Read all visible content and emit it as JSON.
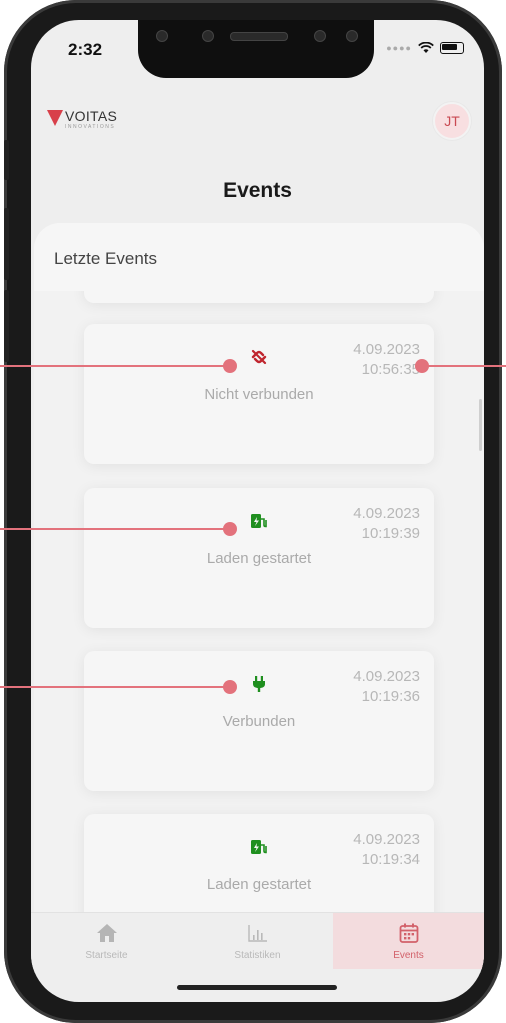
{
  "status_bar": {
    "time": "2:32"
  },
  "header": {
    "logo_name": "VOITAS",
    "logo_sub": "INNOVATIONS",
    "avatar_initials": "JT",
    "title": "Events"
  },
  "panel": {
    "title": "Letzte Events"
  },
  "events": [
    {
      "label": "Nicht verbunden",
      "date": "4.09.2023",
      "time": "10:56:35",
      "icon": "disconnected-icon",
      "color": "#c0262f"
    },
    {
      "label": "Laden gestartet",
      "date": "4.09.2023",
      "time": "10:19:39",
      "icon": "charging-station-icon",
      "color": "#1f8f1f"
    },
    {
      "label": "Verbunden",
      "date": "4.09.2023",
      "time": "10:19:36",
      "icon": "plug-icon",
      "color": "#1f8f1f"
    },
    {
      "label": "Laden gestartet",
      "date": "4.09.2023",
      "time": "10:19:34",
      "icon": "charging-station-icon",
      "color": "#1f8f1f"
    }
  ],
  "tabs": [
    {
      "label": "Startseite",
      "icon": "home-icon",
      "active": false
    },
    {
      "label": "Statistiken",
      "icon": "bar-chart-icon",
      "active": false
    },
    {
      "label": "Events",
      "icon": "calendar-icon",
      "active": true
    }
  ],
  "colors": {
    "accent": "#d2616a",
    "annotation": "#e3727c",
    "connected": "#1f8f1f",
    "disconnected": "#c0262f"
  }
}
